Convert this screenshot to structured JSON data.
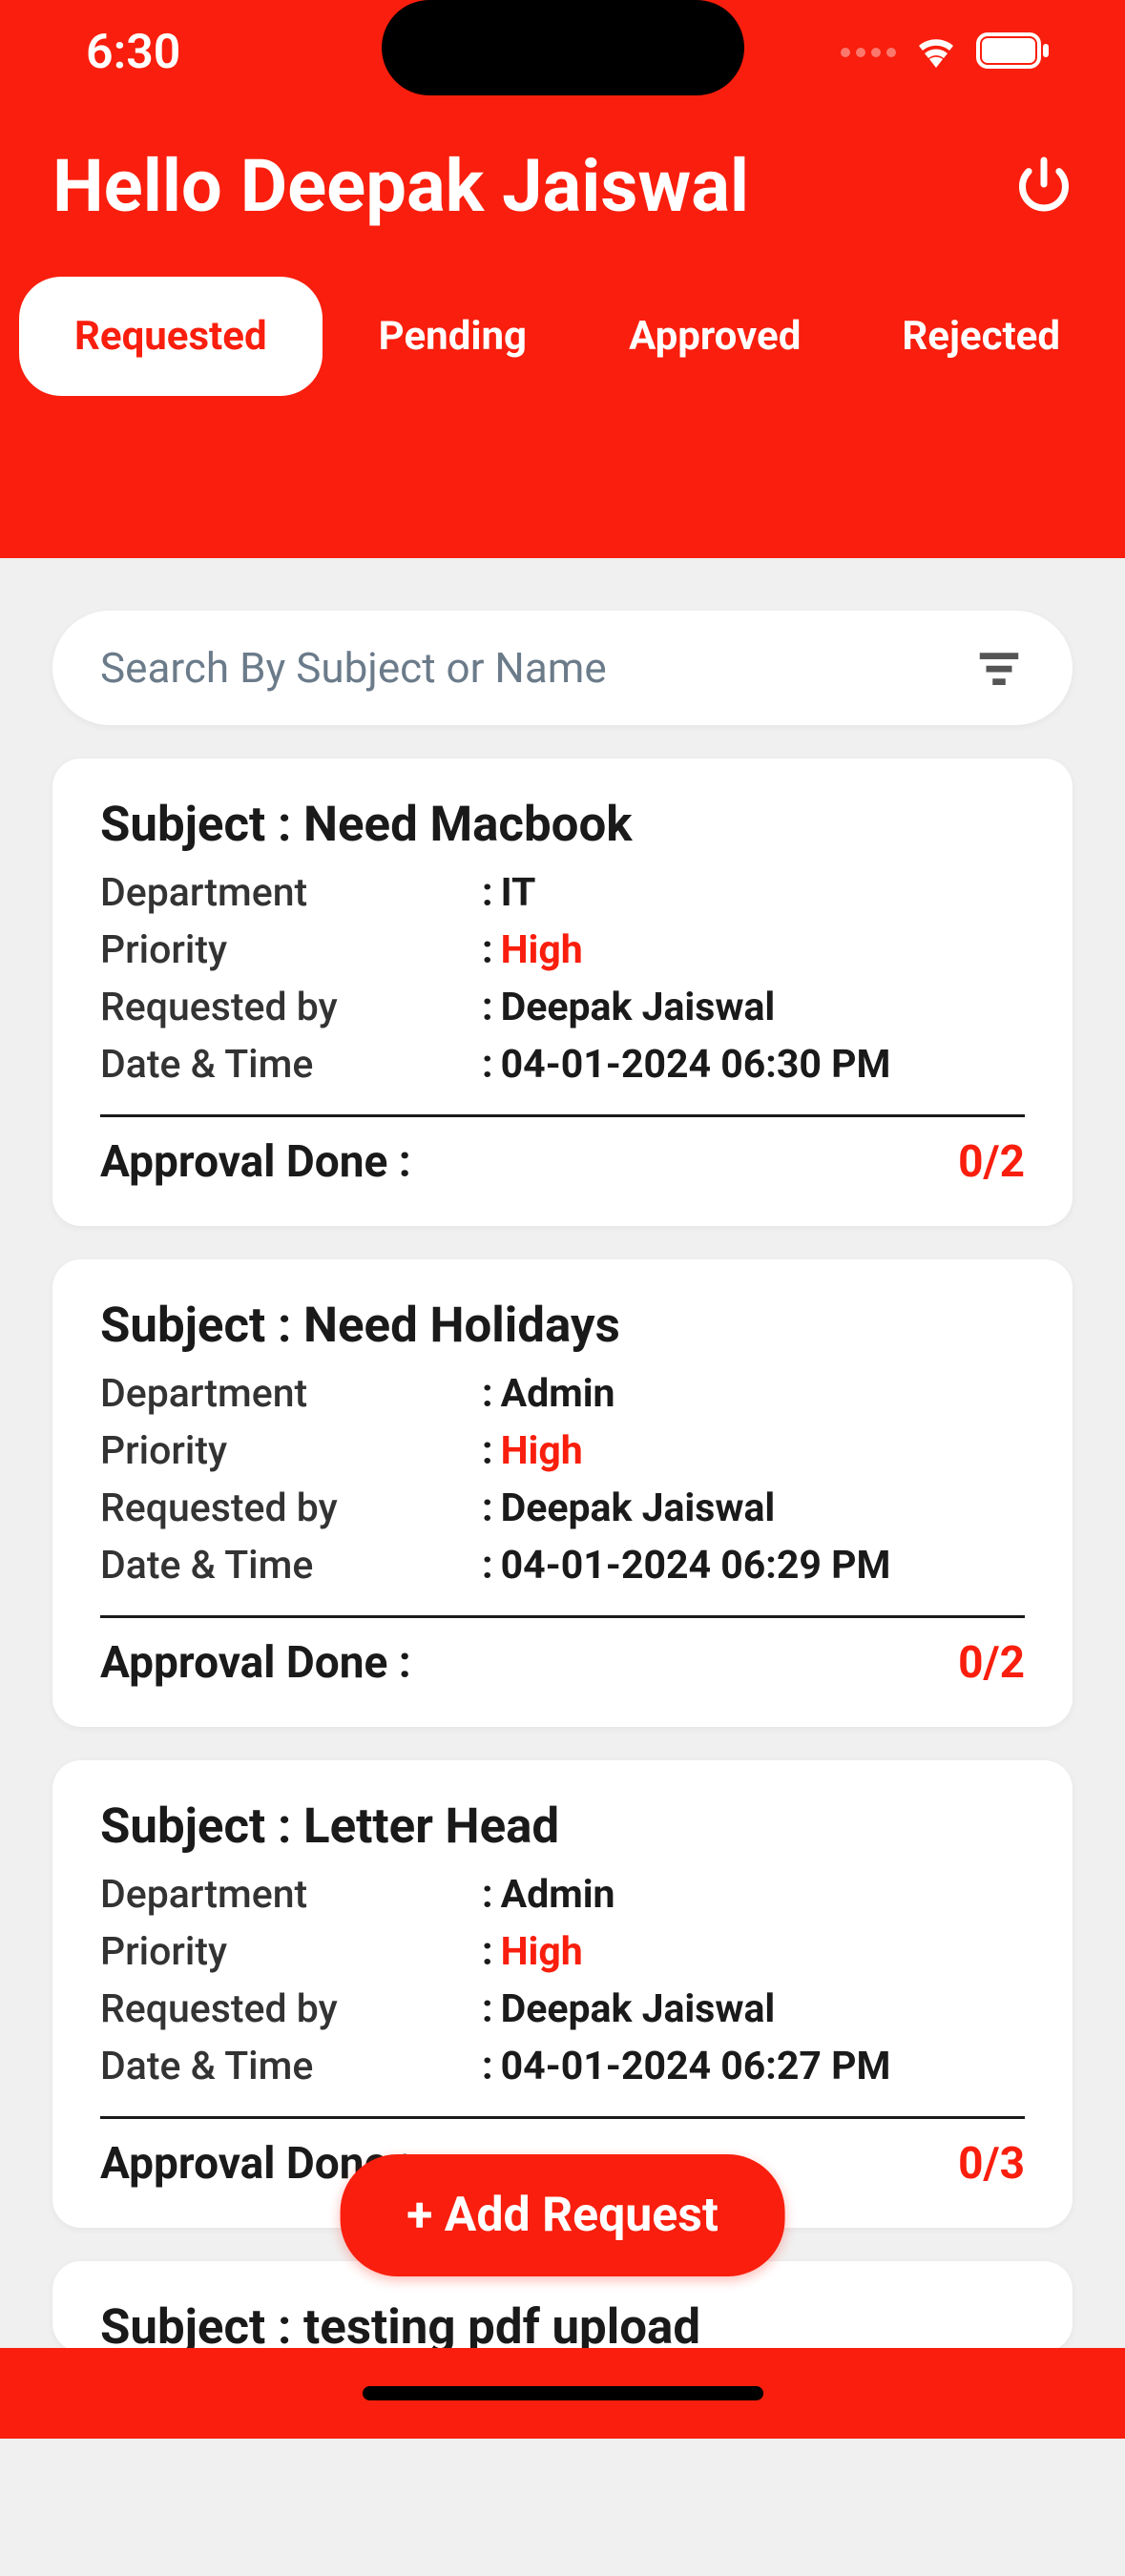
{
  "statusBar": {
    "time": "6:30"
  },
  "header": {
    "greeting": "Hello Deepak Jaiswal"
  },
  "tabs": {
    "requested": "Requested",
    "pending": "Pending",
    "approved": "Approved",
    "rejected": "Rejected"
  },
  "search": {
    "placeholder": "Search By Subject or Name"
  },
  "labels": {
    "subjectPrefix": "Subject : ",
    "department": "Department",
    "priority": "Priority",
    "requestedBy": "Requested by",
    "dateTime": "Date & Time",
    "approvalDone": "Approval Done :"
  },
  "cards": [
    {
      "subject": "Need Macbook",
      "department": "IT",
      "priority": "High",
      "requestedBy": "Deepak Jaiswal",
      "dateTime": "04-01-2024 06:30 PM",
      "approvalCount": "0/2"
    },
    {
      "subject": "Need Holidays",
      "department": "Admin",
      "priority": "High",
      "requestedBy": "Deepak Jaiswal",
      "dateTime": "04-01-2024 06:29 PM",
      "approvalCount": "0/2"
    },
    {
      "subject": "Letter Head",
      "department": "Admin",
      "priority": "High",
      "requestedBy": "Deepak Jaiswal",
      "dateTime": "04-01-2024 06:27 PM",
      "approvalCount": "0/3"
    },
    {
      "subject": "testing pdf upload"
    }
  ],
  "fab": {
    "label": "+ Add Request"
  }
}
